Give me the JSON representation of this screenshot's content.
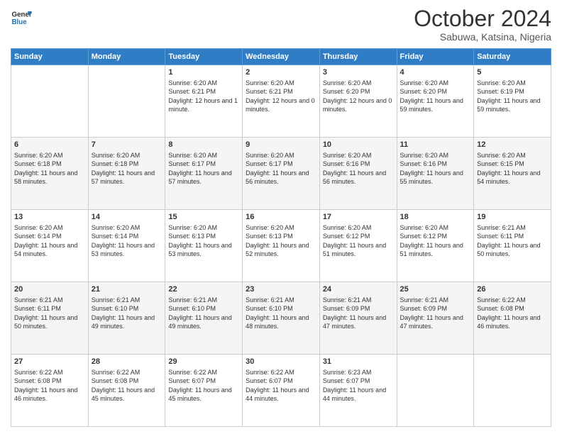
{
  "logo": {
    "line1": "General",
    "line2": "Blue"
  },
  "title": "October 2024",
  "location": "Sabuwa, Katsina, Nigeria",
  "days_header": [
    "Sunday",
    "Monday",
    "Tuesday",
    "Wednesday",
    "Thursday",
    "Friday",
    "Saturday"
  ],
  "weeks": [
    [
      {
        "day": "",
        "info": ""
      },
      {
        "day": "",
        "info": ""
      },
      {
        "day": "1",
        "info": "Sunrise: 6:20 AM\nSunset: 6:21 PM\nDaylight: 12 hours and 1 minute."
      },
      {
        "day": "2",
        "info": "Sunrise: 6:20 AM\nSunset: 6:21 PM\nDaylight: 12 hours and 0 minutes."
      },
      {
        "day": "3",
        "info": "Sunrise: 6:20 AM\nSunset: 6:20 PM\nDaylight: 12 hours and 0 minutes."
      },
      {
        "day": "4",
        "info": "Sunrise: 6:20 AM\nSunset: 6:20 PM\nDaylight: 11 hours and 59 minutes."
      },
      {
        "day": "5",
        "info": "Sunrise: 6:20 AM\nSunset: 6:19 PM\nDaylight: 11 hours and 59 minutes."
      }
    ],
    [
      {
        "day": "6",
        "info": "Sunrise: 6:20 AM\nSunset: 6:18 PM\nDaylight: 11 hours and 58 minutes."
      },
      {
        "day": "7",
        "info": "Sunrise: 6:20 AM\nSunset: 6:18 PM\nDaylight: 11 hours and 57 minutes."
      },
      {
        "day": "8",
        "info": "Sunrise: 6:20 AM\nSunset: 6:17 PM\nDaylight: 11 hours and 57 minutes."
      },
      {
        "day": "9",
        "info": "Sunrise: 6:20 AM\nSunset: 6:17 PM\nDaylight: 11 hours and 56 minutes."
      },
      {
        "day": "10",
        "info": "Sunrise: 6:20 AM\nSunset: 6:16 PM\nDaylight: 11 hours and 56 minutes."
      },
      {
        "day": "11",
        "info": "Sunrise: 6:20 AM\nSunset: 6:16 PM\nDaylight: 11 hours and 55 minutes."
      },
      {
        "day": "12",
        "info": "Sunrise: 6:20 AM\nSunset: 6:15 PM\nDaylight: 11 hours and 54 minutes."
      }
    ],
    [
      {
        "day": "13",
        "info": "Sunrise: 6:20 AM\nSunset: 6:14 PM\nDaylight: 11 hours and 54 minutes."
      },
      {
        "day": "14",
        "info": "Sunrise: 6:20 AM\nSunset: 6:14 PM\nDaylight: 11 hours and 53 minutes."
      },
      {
        "day": "15",
        "info": "Sunrise: 6:20 AM\nSunset: 6:13 PM\nDaylight: 11 hours and 53 minutes."
      },
      {
        "day": "16",
        "info": "Sunrise: 6:20 AM\nSunset: 6:13 PM\nDaylight: 11 hours and 52 minutes."
      },
      {
        "day": "17",
        "info": "Sunrise: 6:20 AM\nSunset: 6:12 PM\nDaylight: 11 hours and 51 minutes."
      },
      {
        "day": "18",
        "info": "Sunrise: 6:20 AM\nSunset: 6:12 PM\nDaylight: 11 hours and 51 minutes."
      },
      {
        "day": "19",
        "info": "Sunrise: 6:21 AM\nSunset: 6:11 PM\nDaylight: 11 hours and 50 minutes."
      }
    ],
    [
      {
        "day": "20",
        "info": "Sunrise: 6:21 AM\nSunset: 6:11 PM\nDaylight: 11 hours and 50 minutes."
      },
      {
        "day": "21",
        "info": "Sunrise: 6:21 AM\nSunset: 6:10 PM\nDaylight: 11 hours and 49 minutes."
      },
      {
        "day": "22",
        "info": "Sunrise: 6:21 AM\nSunset: 6:10 PM\nDaylight: 11 hours and 49 minutes."
      },
      {
        "day": "23",
        "info": "Sunrise: 6:21 AM\nSunset: 6:10 PM\nDaylight: 11 hours and 48 minutes."
      },
      {
        "day": "24",
        "info": "Sunrise: 6:21 AM\nSunset: 6:09 PM\nDaylight: 11 hours and 47 minutes."
      },
      {
        "day": "25",
        "info": "Sunrise: 6:21 AM\nSunset: 6:09 PM\nDaylight: 11 hours and 47 minutes."
      },
      {
        "day": "26",
        "info": "Sunrise: 6:22 AM\nSunset: 6:08 PM\nDaylight: 11 hours and 46 minutes."
      }
    ],
    [
      {
        "day": "27",
        "info": "Sunrise: 6:22 AM\nSunset: 6:08 PM\nDaylight: 11 hours and 46 minutes."
      },
      {
        "day": "28",
        "info": "Sunrise: 6:22 AM\nSunset: 6:08 PM\nDaylight: 11 hours and 45 minutes."
      },
      {
        "day": "29",
        "info": "Sunrise: 6:22 AM\nSunset: 6:07 PM\nDaylight: 11 hours and 45 minutes."
      },
      {
        "day": "30",
        "info": "Sunrise: 6:22 AM\nSunset: 6:07 PM\nDaylight: 11 hours and 44 minutes."
      },
      {
        "day": "31",
        "info": "Sunrise: 6:23 AM\nSunset: 6:07 PM\nDaylight: 11 hours and 44 minutes."
      },
      {
        "day": "",
        "info": ""
      },
      {
        "day": "",
        "info": ""
      }
    ]
  ]
}
